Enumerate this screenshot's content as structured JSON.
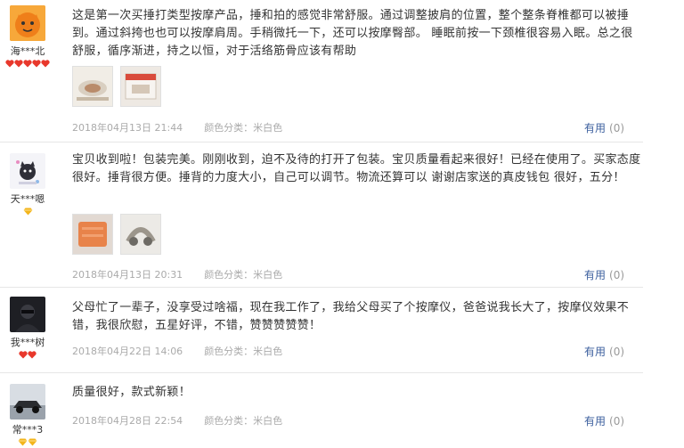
{
  "reviews": [
    {
      "username": "海***北",
      "rank": "hearts",
      "rank_count": 5,
      "text": "这是第一次买捶打类型按摩产品，捶和拍的感觉非常舒服。通过调整披肩的位置，整个整条脊椎都可以被捶到。通过斜挎也也可以按摩肩周。手稍微托一下，还可以按摩臀部。 睡眠前按一下颈椎很容易入眠。总之很舒服，循序渐进，持之以恒，对于活络筋骨应该有帮助",
      "photos": [
        "product-photo-massager",
        "product-photo-box"
      ],
      "date": "2018年04月13日 21:44",
      "sku": "颜色分类：米白色",
      "useful_label": "有用",
      "useful_count": "(0)"
    },
    {
      "username": "天***嗯",
      "rank": "diamond",
      "rank_count": 1,
      "text": "宝贝收到啦！包装完美。刚刚收到，迫不及待的打开了包装。宝贝质量看起来很好！已经在使用了。买家态度很好。捶背很方便。捶背的力度大小，自己可以调节。物流还算可以 谢谢店家送的真皮钱包 很好，五分！",
      "photos": [
        "gift-wallet-photo",
        "massager-photo"
      ],
      "date": "2018年04月13日 20:31",
      "sku": "颜色分类：米白色",
      "useful_label": "有用",
      "useful_count": "(0)"
    },
    {
      "username": "我***树",
      "rank": "hearts",
      "rank_count": 2,
      "text": "父母忙了一辈子，没享受过啥福，现在我工作了，我给父母买了个按摩仪，爸爸说我长大了，按摩仪效果不错，我很欣慰，五星好评，不错，赞赞赞赞赞！",
      "photos": [],
      "date": "2018年04月22日 14:06",
      "sku": "颜色分类：米白色",
      "useful_label": "有用",
      "useful_count": "(0)"
    },
    {
      "username": "常***3",
      "rank": "diamond",
      "rank_count": 2,
      "text": "质量很好，款式新颖！",
      "photos": [],
      "date": "2018年04月28日 22:54",
      "sku": "颜色分类：米白色",
      "useful_label": "有用",
      "useful_count": "(0)"
    }
  ],
  "colors": {
    "text": "#333333",
    "meta": "#aaaaaa",
    "link": "#3c5f9e",
    "divider": "#e6e6e6",
    "heart": "#e8382c",
    "diamond": "#f3b51c"
  }
}
